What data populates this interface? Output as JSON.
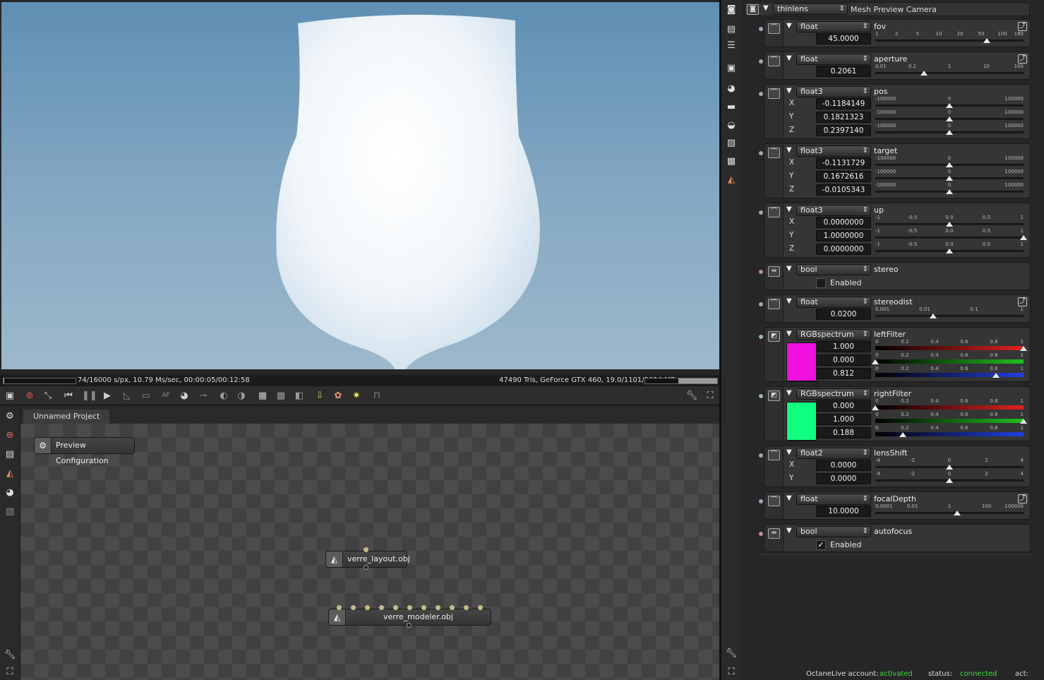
{
  "viewport": {
    "status_left": "74/16000 s/px, 10.79 Ms/sec, 00:00:05/00:12:58",
    "status_right": "47490 Tris, GeForce GTX 460, 19.0/1101/2014 MB",
    "progress": 0.005,
    "memory_usage": 0.54
  },
  "toolbar_icons": [
    "save-render-icon",
    "render-stop-icon",
    "fit-icon",
    "restart-icon",
    "pause-icon",
    "play-icon",
    "clay-icon",
    "monitor-icon",
    "af-icon",
    "camera-icon",
    "picker-icon",
    "sphere-icon",
    "sphere2-icon",
    "grid-icon",
    "checker-icon",
    "region-icon",
    "export-icon",
    "material-icon",
    "light-icon",
    "lock-icon",
    "wrench-icon",
    "fullscreen-icon"
  ],
  "graph": {
    "tab": "Unnamed Project",
    "preview_node": "Preview Configuration",
    "nodes": [
      {
        "label": "verre_layout.obj"
      },
      {
        "label": "verre_modeler.obj"
      }
    ]
  },
  "inspector": {
    "camera_type": "thinlens",
    "camera_name": "Mesh Preview Camera",
    "params": [
      {
        "type": "float",
        "name": "fov",
        "values": [
          "45.0000"
        ],
        "ticks": [
          "1",
          "2",
          "5",
          "10",
          "20",
          "50",
          "100",
          "180"
        ],
        "slider": [
          0.75
        ]
      },
      {
        "type": "float",
        "name": "aperture",
        "values": [
          "0.2061"
        ],
        "ticks": [
          "0.01",
          "0.1",
          "1",
          "10",
          "100"
        ],
        "slider": [
          0.33
        ]
      },
      {
        "type": "float3",
        "name": "pos",
        "axes": [
          "X",
          "Y",
          "Z"
        ],
        "values": [
          "-0.1184149",
          "0.1821323",
          "0.2397140"
        ],
        "ticks": [
          "-100000",
          "0",
          "100000"
        ],
        "slider": [
          0.5,
          0.5,
          0.5
        ]
      },
      {
        "type": "float3",
        "name": "target",
        "axes": [
          "X",
          "Y",
          "Z"
        ],
        "values": [
          "-0.1131729",
          "0.1672616",
          "-0.0105343"
        ],
        "ticks": [
          "-100000",
          "0",
          "100000"
        ],
        "slider": [
          0.5,
          0.5,
          0.5
        ]
      },
      {
        "type": "float3",
        "name": "up",
        "axes": [
          "X",
          "Y",
          "Z"
        ],
        "values": [
          "0.0000000",
          "1.0000000",
          "0.0000000"
        ],
        "ticks": [
          "-1",
          "-0.5",
          "0.0",
          "0.5",
          "1"
        ],
        "slider": [
          0.5,
          1.0,
          0.5
        ]
      },
      {
        "type": "bool",
        "name": "stereo",
        "checkbox": "Enabled",
        "checked": false
      },
      {
        "type": "float",
        "name": "stereodist",
        "values": [
          "0.0200"
        ],
        "ticks": [
          "0.001",
          "0.01",
          "0.1",
          "1"
        ],
        "slider": [
          0.39
        ]
      },
      {
        "type": "RGBspectrum",
        "name": "leftFilter",
        "values": [
          "1.000",
          "0.000",
          "0.812"
        ],
        "ticks": [
          "0",
          "0.2",
          "0.4",
          "0.6",
          "0.8",
          "1"
        ],
        "slider": [
          1.0,
          0.0,
          0.812
        ],
        "color": "#f010e0"
      },
      {
        "type": "RGBspectrum",
        "name": "rightFilter",
        "values": [
          "0.000",
          "1.000",
          "0.188"
        ],
        "ticks": [
          "0",
          "0.2",
          "0.4",
          "0.6",
          "0.8",
          "1"
        ],
        "slider": [
          0.0,
          1.0,
          0.188
        ],
        "color": "#10ff80"
      },
      {
        "type": "float2",
        "name": "lensShift",
        "axes": [
          "X",
          "Y"
        ],
        "values": [
          "0.0000",
          "0.0000"
        ],
        "ticks": [
          "-4",
          "-2",
          "0",
          "2",
          "4"
        ],
        "slider": [
          0.5,
          0.5
        ]
      },
      {
        "type": "float",
        "name": "focalDepth",
        "values": [
          "10.0000"
        ],
        "ticks": [
          "0.0001",
          "0.01",
          "1",
          "100",
          "100000"
        ],
        "slider": [
          0.55
        ]
      },
      {
        "type": "bool",
        "name": "autofocus",
        "checkbox": "Enabled",
        "checked": true
      }
    ]
  },
  "footer": {
    "account_label": "OctaneLive account:",
    "account_value": "activated",
    "status_label": "status:",
    "status_value": "connected",
    "act_label": "act:",
    "accent": "#3ddc3d"
  }
}
